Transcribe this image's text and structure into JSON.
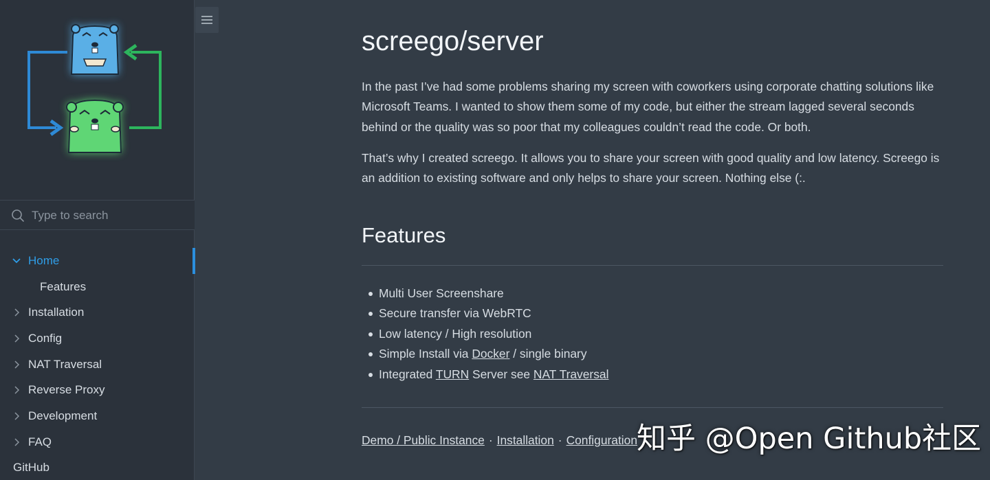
{
  "sidebar": {
    "search_placeholder": "Type to search",
    "items": [
      {
        "label": "Home",
        "active": true,
        "expanded": true
      },
      {
        "label": "Features",
        "sub": true
      },
      {
        "label": "Installation"
      },
      {
        "label": "Config"
      },
      {
        "label": "NAT Traversal"
      },
      {
        "label": "Reverse Proxy"
      },
      {
        "label": "Development"
      },
      {
        "label": "FAQ"
      },
      {
        "label": "GitHub",
        "plain": true
      }
    ]
  },
  "main": {
    "title": "screego/server",
    "intro_1": "In the past I’ve had some problems sharing my screen with coworkers using corporate chatting solutions like Microsoft Teams. I wanted to show them some of my code, but either the stream lagged several seconds behind or the quality was so poor that my colleagues couldn’t read the code. Or both.",
    "intro_2": "That’s why I created screego. It allows you to share your screen with good quality and low latency. Screego is an addition to existing software and only helps to share your screen. Nothing else (:.",
    "features_heading": "Features",
    "features": {
      "f1": "Multi User Screenshare",
      "f2": "Secure transfer via WebRTC",
      "f3": "Low latency / High resolution",
      "f4_pre": "Simple Install via ",
      "f4_link": "Docker",
      "f4_post": " / single binary",
      "f5_pre": "Integrated ",
      "f5_link1": "TURN",
      "f5_mid": " Server see ",
      "f5_link2": "NAT Traversal"
    },
    "footer_links": {
      "demo": "Demo / Public Instance",
      "install": "Installation",
      "config": "Configuration",
      "sep": "·"
    }
  },
  "watermark": "知乎 @Open Github社区",
  "colors": {
    "accent": "#2f9ee8",
    "sidebar_bg": "#2b323b",
    "main_bg": "#333c46",
    "blue_gopher": "#5aafe6",
    "green_gopher": "#5fd675"
  }
}
